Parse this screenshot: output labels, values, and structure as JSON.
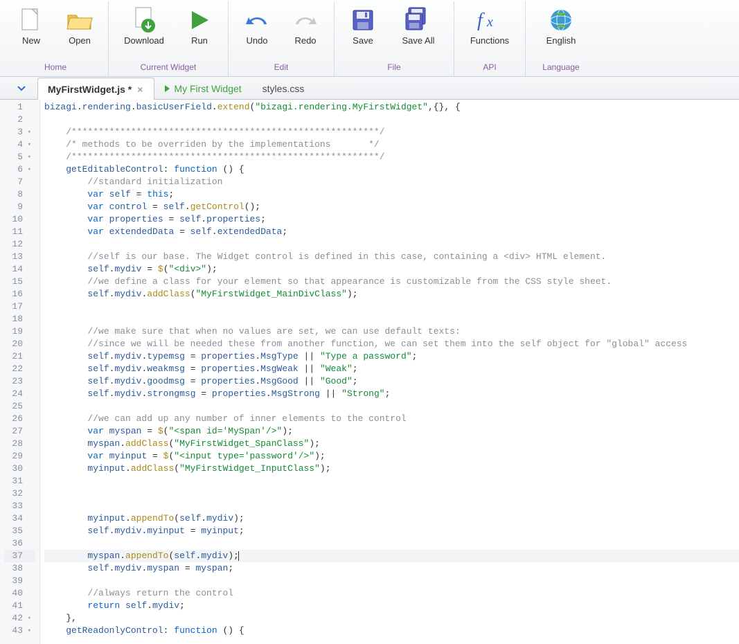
{
  "ribbon": {
    "groups": [
      {
        "title": "Home",
        "items": [
          {
            "id": "new",
            "label": "New"
          },
          {
            "id": "open",
            "label": "Open"
          }
        ]
      },
      {
        "title": "Current Widget",
        "items": [
          {
            "id": "download",
            "label": "Download"
          },
          {
            "id": "run",
            "label": "Run"
          }
        ]
      },
      {
        "title": "Edit",
        "items": [
          {
            "id": "undo",
            "label": "Undo"
          },
          {
            "id": "redo",
            "label": "Redo"
          }
        ]
      },
      {
        "title": "File",
        "items": [
          {
            "id": "save",
            "label": "Save"
          },
          {
            "id": "saveall",
            "label": "Save All"
          }
        ]
      },
      {
        "title": "API",
        "items": [
          {
            "id": "functions",
            "label": "Functions"
          }
        ]
      },
      {
        "title": "Language",
        "items": [
          {
            "id": "english",
            "label": "English"
          }
        ]
      }
    ]
  },
  "tabs": [
    {
      "label": "MyFirstWidget.js *",
      "active": true,
      "closable": true,
      "kind": "file"
    },
    {
      "label": "My First Widget",
      "active": false,
      "closable": false,
      "kind": "preview"
    },
    {
      "label": "styles.css",
      "active": false,
      "closable": false,
      "kind": "file"
    }
  ],
  "editor": {
    "highlight_line": 37,
    "lines": [
      {
        "n": 1,
        "fold": "",
        "tokens": [
          [
            "id",
            "bizagi"
          ],
          [
            "pun",
            "."
          ],
          [
            "id",
            "rendering"
          ],
          [
            "pun",
            "."
          ],
          [
            "id",
            "basicUserField"
          ],
          [
            "pun",
            "."
          ],
          [
            "fn",
            "extend"
          ],
          [
            "pun",
            "("
          ],
          [
            "str",
            "\"bizagi.rendering.MyFirstWidget\""
          ],
          [
            "pun",
            ",{}, {"
          ]
        ]
      },
      {
        "n": 2,
        "fold": "",
        "tokens": []
      },
      {
        "n": 3,
        "fold": "▾",
        "tokens": [
          [
            "pun",
            "    "
          ],
          [
            "cmt",
            "/*********************************************************/"
          ]
        ]
      },
      {
        "n": 4,
        "fold": "▾",
        "tokens": [
          [
            "pun",
            "    "
          ],
          [
            "cmt",
            "/* methods to be overriden by the implementations       */"
          ]
        ]
      },
      {
        "n": 5,
        "fold": "▾",
        "tokens": [
          [
            "pun",
            "    "
          ],
          [
            "cmt",
            "/*********************************************************/"
          ]
        ]
      },
      {
        "n": 6,
        "fold": "▾",
        "tokens": [
          [
            "pun",
            "    "
          ],
          [
            "id",
            "getEditableControl"
          ],
          [
            "pun",
            ": "
          ],
          [
            "kw",
            "function"
          ],
          [
            "pun",
            " () {"
          ]
        ]
      },
      {
        "n": 7,
        "fold": "",
        "tokens": [
          [
            "pun",
            "        "
          ],
          [
            "cmt",
            "//standard initialization"
          ]
        ]
      },
      {
        "n": 8,
        "fold": "",
        "tokens": [
          [
            "pun",
            "        "
          ],
          [
            "kw",
            "var"
          ],
          [
            "pun",
            " "
          ],
          [
            "id",
            "self"
          ],
          [
            "pun",
            " = "
          ],
          [
            "kw",
            "this"
          ],
          [
            "pun",
            ";"
          ]
        ]
      },
      {
        "n": 9,
        "fold": "",
        "tokens": [
          [
            "pun",
            "        "
          ],
          [
            "kw",
            "var"
          ],
          [
            "pun",
            " "
          ],
          [
            "id",
            "control"
          ],
          [
            "pun",
            " = "
          ],
          [
            "id",
            "self"
          ],
          [
            "pun",
            "."
          ],
          [
            "fn",
            "getControl"
          ],
          [
            "pun",
            "();"
          ]
        ]
      },
      {
        "n": 10,
        "fold": "",
        "tokens": [
          [
            "pun",
            "        "
          ],
          [
            "kw",
            "var"
          ],
          [
            "pun",
            " "
          ],
          [
            "id",
            "properties"
          ],
          [
            "pun",
            " = "
          ],
          [
            "id",
            "self"
          ],
          [
            "pun",
            "."
          ],
          [
            "id",
            "properties"
          ],
          [
            "pun",
            ";"
          ]
        ]
      },
      {
        "n": 11,
        "fold": "",
        "tokens": [
          [
            "pun",
            "        "
          ],
          [
            "kw",
            "var"
          ],
          [
            "pun",
            " "
          ],
          [
            "id",
            "extendedData"
          ],
          [
            "pun",
            " = "
          ],
          [
            "id",
            "self"
          ],
          [
            "pun",
            "."
          ],
          [
            "id",
            "extendedData"
          ],
          [
            "pun",
            ";"
          ]
        ]
      },
      {
        "n": 12,
        "fold": "",
        "tokens": []
      },
      {
        "n": 13,
        "fold": "",
        "tokens": [
          [
            "pun",
            "        "
          ],
          [
            "cmt",
            "//self is our base. The Widget control is defined in this case, containing a <div> HTML element."
          ]
        ]
      },
      {
        "n": 14,
        "fold": "",
        "tokens": [
          [
            "pun",
            "        "
          ],
          [
            "id",
            "self"
          ],
          [
            "pun",
            "."
          ],
          [
            "id",
            "mydiv"
          ],
          [
            "pun",
            " = "
          ],
          [
            "fn",
            "$"
          ],
          [
            "pun",
            "("
          ],
          [
            "str",
            "\"<div>\""
          ],
          [
            "pun",
            ");"
          ]
        ]
      },
      {
        "n": 15,
        "fold": "",
        "tokens": [
          [
            "pun",
            "        "
          ],
          [
            "cmt",
            "//we define a class for your element so that appearance is customizable from the CSS style sheet."
          ]
        ]
      },
      {
        "n": 16,
        "fold": "",
        "tokens": [
          [
            "pun",
            "        "
          ],
          [
            "id",
            "self"
          ],
          [
            "pun",
            "."
          ],
          [
            "id",
            "mydiv"
          ],
          [
            "pun",
            "."
          ],
          [
            "fn",
            "addClass"
          ],
          [
            "pun",
            "("
          ],
          [
            "str",
            "\"MyFirstWidget_MainDivClass\""
          ],
          [
            "pun",
            ");"
          ]
        ]
      },
      {
        "n": 17,
        "fold": "",
        "tokens": []
      },
      {
        "n": 18,
        "fold": "",
        "tokens": []
      },
      {
        "n": 19,
        "fold": "",
        "tokens": [
          [
            "pun",
            "        "
          ],
          [
            "cmt",
            "//we make sure that when no values are set, we can use default texts:"
          ]
        ]
      },
      {
        "n": 20,
        "fold": "",
        "tokens": [
          [
            "pun",
            "        "
          ],
          [
            "cmt",
            "//since we will be needed these from another function, we can set them into the self object for \"global\" access"
          ]
        ]
      },
      {
        "n": 21,
        "fold": "",
        "tokens": [
          [
            "pun",
            "        "
          ],
          [
            "id",
            "self"
          ],
          [
            "pun",
            "."
          ],
          [
            "id",
            "mydiv"
          ],
          [
            "pun",
            "."
          ],
          [
            "id",
            "typemsg"
          ],
          [
            "pun",
            " = "
          ],
          [
            "id",
            "properties"
          ],
          [
            "pun",
            "."
          ],
          [
            "id",
            "MsgType"
          ],
          [
            "pun",
            " || "
          ],
          [
            "str",
            "\"Type a password\""
          ],
          [
            "pun",
            ";"
          ]
        ]
      },
      {
        "n": 22,
        "fold": "",
        "tokens": [
          [
            "pun",
            "        "
          ],
          [
            "id",
            "self"
          ],
          [
            "pun",
            "."
          ],
          [
            "id",
            "mydiv"
          ],
          [
            "pun",
            "."
          ],
          [
            "id",
            "weakmsg"
          ],
          [
            "pun",
            " = "
          ],
          [
            "id",
            "properties"
          ],
          [
            "pun",
            "."
          ],
          [
            "id",
            "MsgWeak"
          ],
          [
            "pun",
            " || "
          ],
          [
            "str",
            "\"Weak\""
          ],
          [
            "pun",
            ";"
          ]
        ]
      },
      {
        "n": 23,
        "fold": "",
        "tokens": [
          [
            "pun",
            "        "
          ],
          [
            "id",
            "self"
          ],
          [
            "pun",
            "."
          ],
          [
            "id",
            "mydiv"
          ],
          [
            "pun",
            "."
          ],
          [
            "id",
            "goodmsg"
          ],
          [
            "pun",
            " = "
          ],
          [
            "id",
            "properties"
          ],
          [
            "pun",
            "."
          ],
          [
            "id",
            "MsgGood"
          ],
          [
            "pun",
            " || "
          ],
          [
            "str",
            "\"Good\""
          ],
          [
            "pun",
            ";"
          ]
        ]
      },
      {
        "n": 24,
        "fold": "",
        "tokens": [
          [
            "pun",
            "        "
          ],
          [
            "id",
            "self"
          ],
          [
            "pun",
            "."
          ],
          [
            "id",
            "mydiv"
          ],
          [
            "pun",
            "."
          ],
          [
            "id",
            "strongmsg"
          ],
          [
            "pun",
            " = "
          ],
          [
            "id",
            "properties"
          ],
          [
            "pun",
            "."
          ],
          [
            "id",
            "MsgStrong"
          ],
          [
            "pun",
            " || "
          ],
          [
            "str",
            "\"Strong\""
          ],
          [
            "pun",
            ";"
          ]
        ]
      },
      {
        "n": 25,
        "fold": "",
        "tokens": []
      },
      {
        "n": 26,
        "fold": "",
        "tokens": [
          [
            "pun",
            "        "
          ],
          [
            "cmt",
            "//we can add up any number of inner elements to the control"
          ]
        ]
      },
      {
        "n": 27,
        "fold": "",
        "tokens": [
          [
            "pun",
            "        "
          ],
          [
            "kw",
            "var"
          ],
          [
            "pun",
            " "
          ],
          [
            "id",
            "myspan"
          ],
          [
            "pun",
            " = "
          ],
          [
            "fn",
            "$"
          ],
          [
            "pun",
            "("
          ],
          [
            "str",
            "\"<span id='MySpan'/>\""
          ],
          [
            "pun",
            ");"
          ]
        ]
      },
      {
        "n": 28,
        "fold": "",
        "tokens": [
          [
            "pun",
            "        "
          ],
          [
            "id",
            "myspan"
          ],
          [
            "pun",
            "."
          ],
          [
            "fn",
            "addClass"
          ],
          [
            "pun",
            "("
          ],
          [
            "str",
            "\"MyFirstWidget_SpanClass\""
          ],
          [
            "pun",
            ");"
          ]
        ]
      },
      {
        "n": 29,
        "fold": "",
        "tokens": [
          [
            "pun",
            "        "
          ],
          [
            "kw",
            "var"
          ],
          [
            "pun",
            " "
          ],
          [
            "id",
            "myinput"
          ],
          [
            "pun",
            " = "
          ],
          [
            "fn",
            "$"
          ],
          [
            "pun",
            "("
          ],
          [
            "str",
            "\"<input type='password'/>\""
          ],
          [
            "pun",
            ");"
          ]
        ]
      },
      {
        "n": 30,
        "fold": "",
        "tokens": [
          [
            "pun",
            "        "
          ],
          [
            "id",
            "myinput"
          ],
          [
            "pun",
            "."
          ],
          [
            "fn",
            "addClass"
          ],
          [
            "pun",
            "("
          ],
          [
            "str",
            "\"MyFirstWidget_InputClass\""
          ],
          [
            "pun",
            ");"
          ]
        ]
      },
      {
        "n": 31,
        "fold": "",
        "tokens": []
      },
      {
        "n": 32,
        "fold": "",
        "tokens": []
      },
      {
        "n": 33,
        "fold": "",
        "tokens": []
      },
      {
        "n": 34,
        "fold": "",
        "tokens": [
          [
            "pun",
            "        "
          ],
          [
            "id",
            "myinput"
          ],
          [
            "pun",
            "."
          ],
          [
            "fn",
            "appendTo"
          ],
          [
            "pun",
            "("
          ],
          [
            "id",
            "self"
          ],
          [
            "pun",
            "."
          ],
          [
            "id",
            "mydiv"
          ],
          [
            "pun",
            ");"
          ]
        ]
      },
      {
        "n": 35,
        "fold": "",
        "tokens": [
          [
            "pun",
            "        "
          ],
          [
            "id",
            "self"
          ],
          [
            "pun",
            "."
          ],
          [
            "id",
            "mydiv"
          ],
          [
            "pun",
            "."
          ],
          [
            "id",
            "myinput"
          ],
          [
            "pun",
            " = "
          ],
          [
            "id",
            "myinput"
          ],
          [
            "pun",
            ";"
          ]
        ]
      },
      {
        "n": 36,
        "fold": "",
        "tokens": []
      },
      {
        "n": 37,
        "fold": "",
        "tokens": [
          [
            "pun",
            "        "
          ],
          [
            "id",
            "myspan"
          ],
          [
            "pun",
            "."
          ],
          [
            "fn",
            "appendTo"
          ],
          [
            "pun",
            "("
          ],
          [
            "id",
            "self"
          ],
          [
            "pun",
            "."
          ],
          [
            "id",
            "mydiv"
          ],
          [
            "pun",
            ");"
          ]
        ]
      },
      {
        "n": 38,
        "fold": "",
        "tokens": [
          [
            "pun",
            "        "
          ],
          [
            "id",
            "self"
          ],
          [
            "pun",
            "."
          ],
          [
            "id",
            "mydiv"
          ],
          [
            "pun",
            "."
          ],
          [
            "id",
            "myspan"
          ],
          [
            "pun",
            " = "
          ],
          [
            "id",
            "myspan"
          ],
          [
            "pun",
            ";"
          ]
        ]
      },
      {
        "n": 39,
        "fold": "",
        "tokens": []
      },
      {
        "n": 40,
        "fold": "",
        "tokens": [
          [
            "pun",
            "        "
          ],
          [
            "cmt",
            "//always return the control"
          ]
        ]
      },
      {
        "n": 41,
        "fold": "",
        "tokens": [
          [
            "pun",
            "        "
          ],
          [
            "kw",
            "return"
          ],
          [
            "pun",
            " "
          ],
          [
            "id",
            "self"
          ],
          [
            "pun",
            "."
          ],
          [
            "id",
            "mydiv"
          ],
          [
            "pun",
            ";"
          ]
        ]
      },
      {
        "n": 42,
        "fold": "▾",
        "tokens": [
          [
            "pun",
            "    },"
          ]
        ]
      },
      {
        "n": 43,
        "fold": "▾",
        "tokens": [
          [
            "pun",
            "    "
          ],
          [
            "id",
            "getReadonlyControl"
          ],
          [
            "pun",
            ": "
          ],
          [
            "kw",
            "function"
          ],
          [
            "pun",
            " () {"
          ]
        ]
      }
    ]
  }
}
